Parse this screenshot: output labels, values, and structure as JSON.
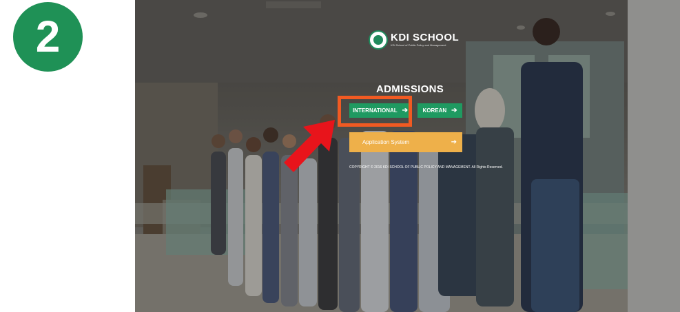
{
  "step": {
    "number": "2",
    "color": "#1f9156"
  },
  "logo": {
    "name": "KDI SCHOOL",
    "subtitle": "KDI School of Public Policy and Management"
  },
  "page": {
    "heading": "ADMISSIONS",
    "buttons": {
      "international": "INTERNATIONAL",
      "korean": "KOREAN",
      "application": "Application System"
    },
    "copyright": "COPYRIGHT © 2016 KDI SCHOOL OF PUBLIC POLICY AND MANAGEMENT. All Rights Reserved."
  },
  "colors": {
    "primary_green": "#1f9a61",
    "application_orange": "#eeb04a",
    "highlight": "#f15a22",
    "callout_arrow": "#e8141b"
  },
  "icons": {
    "button_arrow": "arrow-right-icon",
    "callout": "red-pointer-arrow-icon",
    "logo": "kdi-emblem-icon"
  }
}
